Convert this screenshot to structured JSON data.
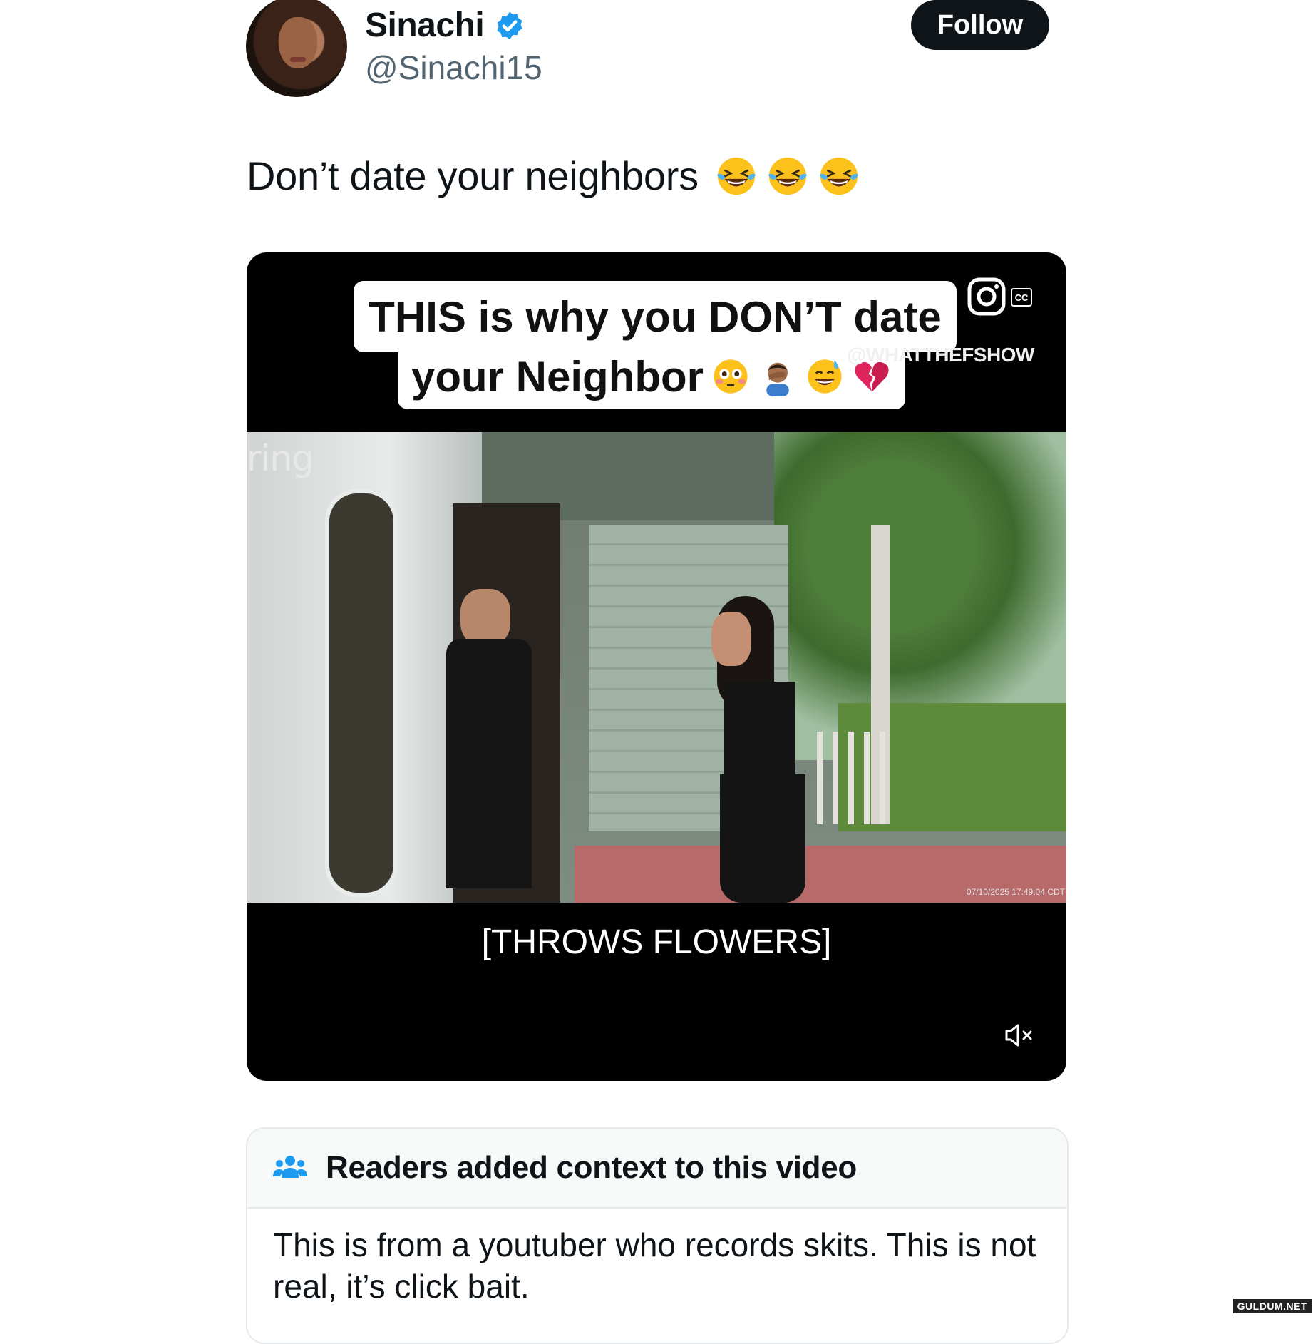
{
  "author": {
    "display_name": "Sinachi",
    "handle": "@Sinachi15",
    "verified": true,
    "verified_color": "#1d9bf0"
  },
  "follow_button": {
    "label": "Follow"
  },
  "tweet": {
    "text": "Don’t date your neighbors",
    "emojis": [
      "laughing-tears-icon",
      "laughing-tears-icon",
      "laughing-tears-icon"
    ]
  },
  "video": {
    "caption_line1": "THIS is why you DON’T date",
    "caption_line2": "your Neighbor",
    "caption_emojis": [
      "flushed-face-icon",
      "facepalm-icon",
      "sweat-smile-icon",
      "broken-heart-icon"
    ],
    "watermark": "@WHATTHEFSHOW",
    "cc_label": "CC",
    "camera_brand": "ring",
    "timestamp": "07/10/2025 17:49:04 CDT",
    "subtitle": "[THROWS FLOWERS]",
    "muted": true
  },
  "community_note": {
    "title": "Readers added context to this video",
    "body": "This is from a youtuber who records skits.  This is not real, it’s click bait.",
    "accent_color": "#1d9bf0"
  },
  "site_watermark": "GULDUM.NET"
}
